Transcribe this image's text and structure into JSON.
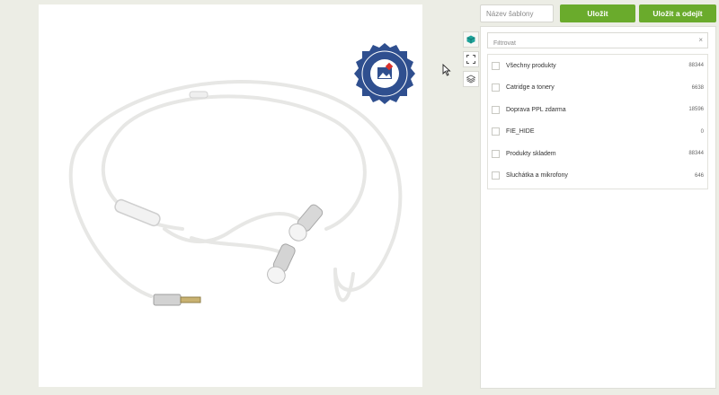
{
  "toolbar": {
    "name_placeholder": "Název šablony",
    "save_label": "Uložit",
    "save_leave_label": "Uložit a odejít"
  },
  "tools": [
    {
      "icon": "cube-icon",
      "active": true
    },
    {
      "icon": "fullscreen-icon",
      "active": false
    },
    {
      "icon": "layers-icon",
      "active": false
    }
  ],
  "badge": {
    "text_top": "POUŽÍVÁME",
    "text_bottom": "FEED IMAGE EDITOR"
  },
  "filter": {
    "placeholder": "Filtrovat",
    "clear_label": "×"
  },
  "categories": [
    {
      "label": "Všechny produkty",
      "count": "88344"
    },
    {
      "label": "Catridge a tonery",
      "count": "6638"
    },
    {
      "label": "Doprava PPL zdarma",
      "count": "18596"
    },
    {
      "label": "FIE_HIDE",
      "count": "0"
    },
    {
      "label": "Produkty skladem",
      "count": "88344"
    },
    {
      "label": "Sluchátka a mikrofony",
      "count": "646"
    }
  ],
  "colors": {
    "accent": "#6aab2c",
    "badge_blue": "#2f4f8f",
    "teal": "#1fa39a"
  }
}
